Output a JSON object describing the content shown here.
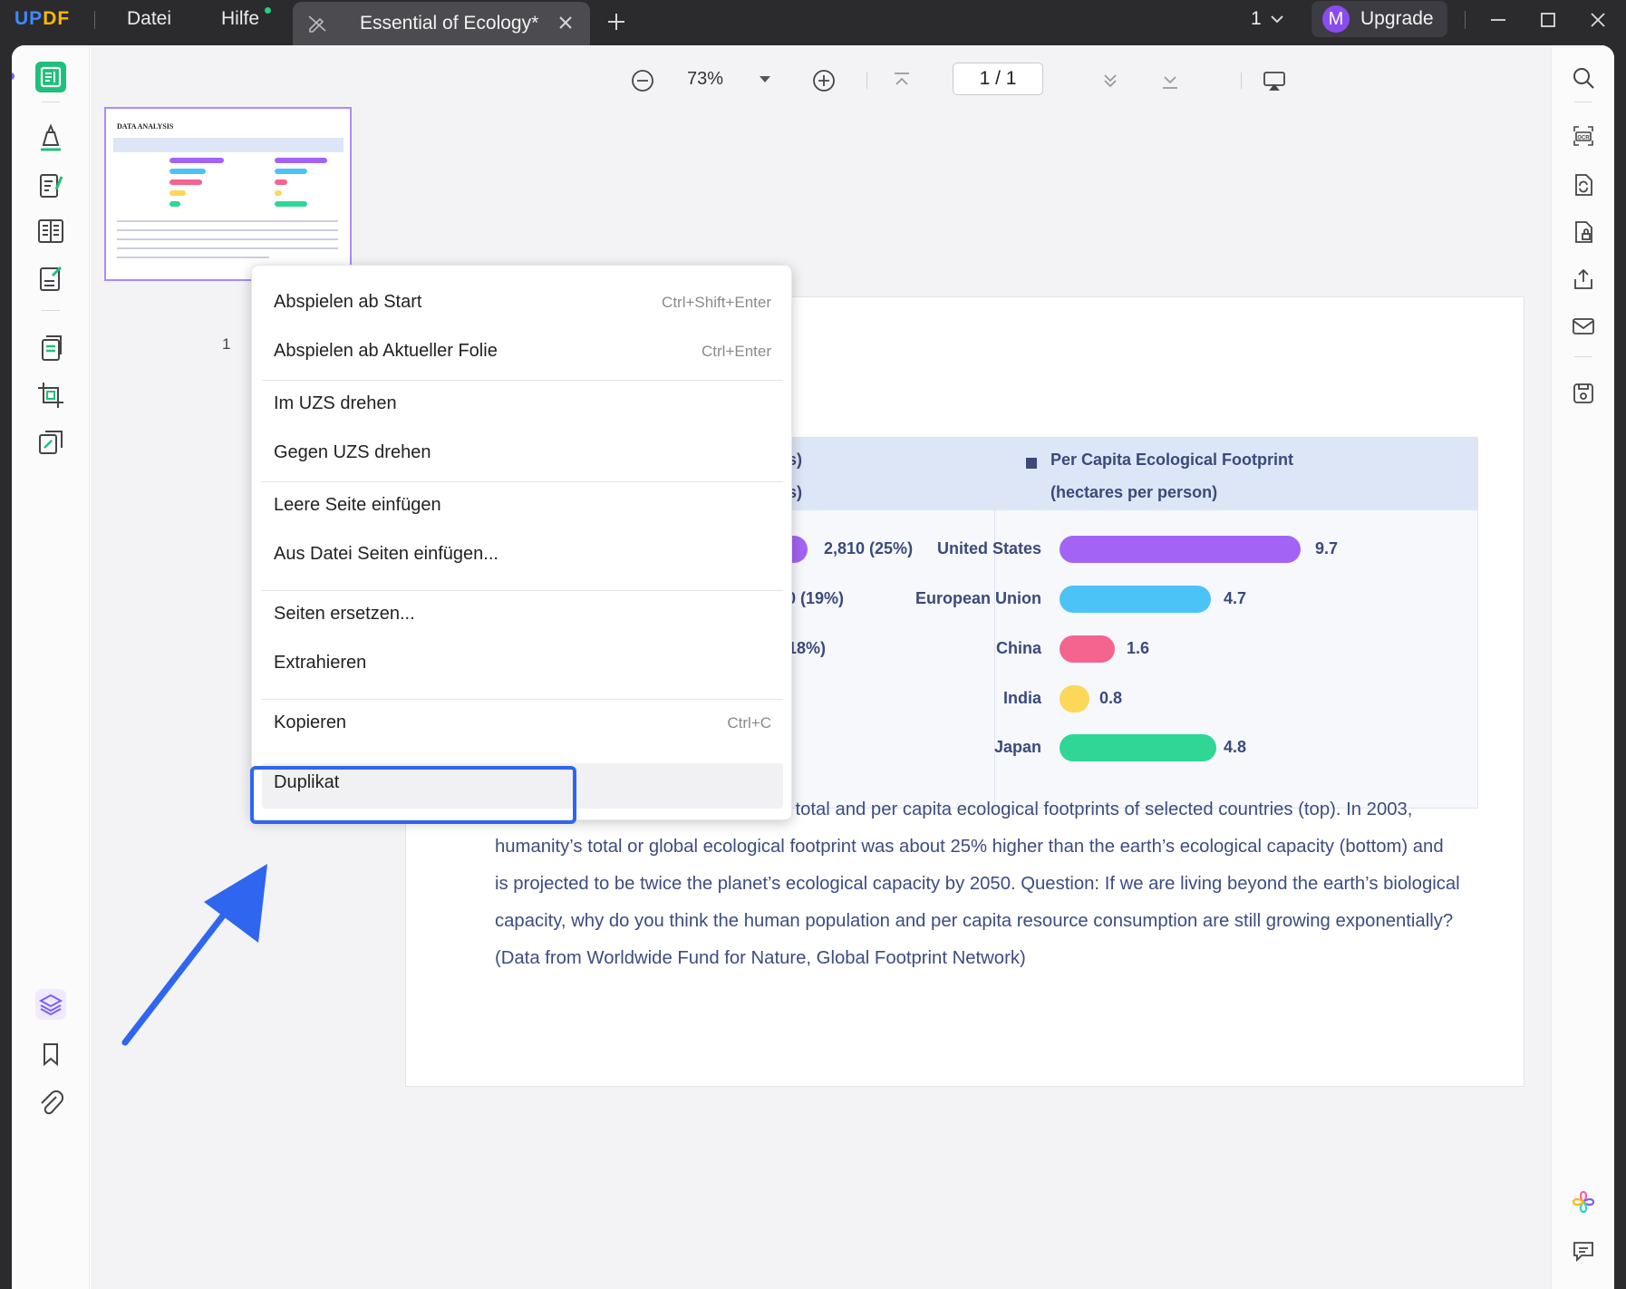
{
  "titlebar": {
    "logo_a": "UP",
    "logo_b": "DF",
    "menu_datei": "Datei",
    "menu_hilfe": "Hilfe",
    "tab_title": "Essential of Ecology*",
    "page_count": "1",
    "avatar_initial": "M",
    "upgrade_label": "Upgrade"
  },
  "thumbnails": {
    "page_number": "1"
  },
  "toolbar": {
    "zoom": "73%",
    "page_indicator": "1 / 1"
  },
  "document": {
    "thumb_title": "DATA ANALYSIS",
    "header_left_line1": "s)",
    "header_left_line2": "s)",
    "header_right_line1": "Per Capita Ecological Footprint",
    "header_right_line2": "(hectares per person)",
    "left_values": [
      "2,810 (25%)",
      ",160 (19%)",
      "i0 (18%)"
    ],
    "left_bar_color": "#a363f5",
    "right_rows": [
      {
        "country": "United States",
        "value": "9.7",
        "color": "#a363f5"
      },
      {
        "country": "European Union",
        "value": "4.7",
        "color": "#4cc3f7"
      },
      {
        "country": "China",
        "value": "1.6",
        "color": "#f5648f"
      },
      {
        "country": "India",
        "value": "0.8",
        "color": "#fbd85a"
      },
      {
        "country": "Japan",
        "value": "4.8",
        "color": "#2fd694"
      }
    ],
    "caption_lines": [
      "Natural capital use and degradation: total and per capita ecological footprints of selected countries (top). In 2003,",
      "humanity’s total or global ecological footprint was about 25% higher than the earth’s ecological capacity (bottom) and",
      "is projected to be twice the planet’s ecological capacity by 2050. Question: If we are living beyond the earth’s biological",
      "capacity, why do you think the human population and per capita resource consumption are still growing exponentially?",
      "(Data from Worldwide Fund for Nature, Global Footprint Network)"
    ]
  },
  "context_menu": {
    "items": [
      {
        "label": "Abspielen ab Start",
        "shortcut": "Ctrl+Shift+Enter"
      },
      {
        "label": "Abspielen ab Aktueller Folie",
        "shortcut": "Ctrl+Enter"
      },
      {
        "label": "Im UZS drehen",
        "shortcut": ""
      },
      {
        "label": "Gegen UZS drehen",
        "shortcut": ""
      },
      {
        "label": "Leere Seite einfügen",
        "shortcut": ""
      },
      {
        "label": "Aus Datei Seiten einfügen...",
        "shortcut": ""
      },
      {
        "label": "Seiten ersetzen...",
        "shortcut": ""
      },
      {
        "label": "Extrahieren",
        "shortcut": ""
      },
      {
        "label": "Kopieren",
        "shortcut": "Ctrl+C"
      },
      {
        "label": "Duplikat",
        "shortcut": ""
      }
    ],
    "highlight_color": "#2f66f0"
  },
  "colors": {
    "accent": "#2f66f0",
    "brand_green": "#1fc07a",
    "thumb_border": "#a98bff"
  }
}
